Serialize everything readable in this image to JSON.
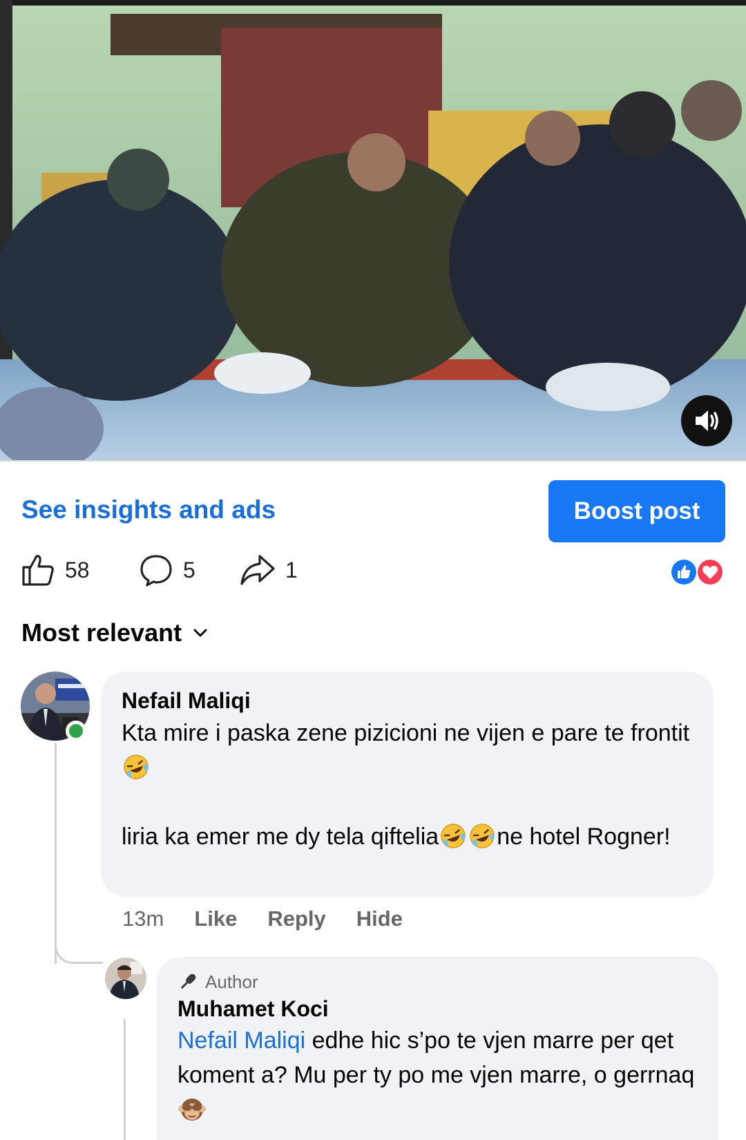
{
  "video": {
    "sound_icon": "speaker-icon"
  },
  "insights": {
    "link_label": "See insights and ads",
    "boost_label": "Boost post"
  },
  "stats": {
    "likes": "58",
    "comments": "5",
    "shares": "1",
    "reactions": [
      "like",
      "love"
    ]
  },
  "sort": {
    "label": "Most relevant"
  },
  "comments": [
    {
      "author": "Nefail Maliqi",
      "online": true,
      "line1": "Kta mire i paska zene pizicioni  ne vijen e pare te frontit",
      "line2a": "liria ka emer me dy tela qiftelia",
      "line2b": "ne hotel Rogner!",
      "time": "13m",
      "actions": [
        "Like",
        "Reply",
        "Hide"
      ]
    },
    {
      "badge": "Author",
      "author": "Muhamet Koci",
      "mention": "Nefail Maliqi",
      "text_a": " edhe hic s’po te vjen marre per qet koment a? Mu per ty po me vjen marre, o gerrnaq"
    }
  ],
  "colors": {
    "accent": "#1877f2",
    "link": "#1a6ed8",
    "bubble": "#f0f2f5",
    "online": "#31a24c",
    "love": "#f33e58"
  }
}
